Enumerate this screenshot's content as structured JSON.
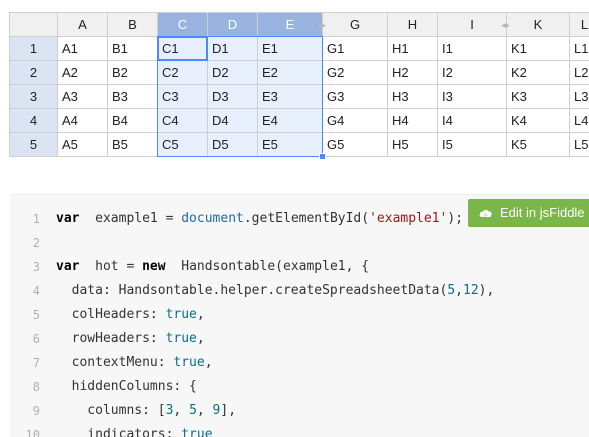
{
  "colors": {
    "header_bg": "#f0f0f0",
    "header_selected_bg": "#99b3df",
    "cell_selected_bg": "#e6effb",
    "selection_border": "#4b89ff",
    "grid_line": "#cfcfcf",
    "jsfiddle_green": "#7ab648",
    "code_bg": "#f7f7f7"
  },
  "spreadsheet": {
    "column_headers": [
      "A",
      "B",
      "C",
      "D",
      "E",
      "G",
      "H",
      "I",
      "K",
      "L"
    ],
    "selected_columns": [
      "C",
      "D",
      "E"
    ],
    "hidden_column_markers": [
      "after E (F hidden)",
      "after I (J hidden)"
    ],
    "row_headers": [
      "1",
      "2",
      "3",
      "4",
      "5"
    ],
    "selected_rows": [
      "1",
      "2",
      "3",
      "4",
      "5"
    ],
    "active_cell": "C1",
    "rows": [
      [
        "A1",
        "B1",
        "C1",
        "D1",
        "E1",
        "G1",
        "H1",
        "I1",
        "K1",
        "L1"
      ],
      [
        "A2",
        "B2",
        "C2",
        "D2",
        "E2",
        "G2",
        "H2",
        "I2",
        "K2",
        "L2"
      ],
      [
        "A3",
        "B3",
        "C3",
        "D3",
        "E3",
        "G3",
        "H3",
        "I3",
        "K3",
        "L3"
      ],
      [
        "A4",
        "B4",
        "C4",
        "D4",
        "E4",
        "G4",
        "H4",
        "I4",
        "K4",
        "L4"
      ],
      [
        "A5",
        "B5",
        "C5",
        "D5",
        "E5",
        "G5",
        "H5",
        "I5",
        "K5",
        "L5"
      ]
    ]
  },
  "code": {
    "lines": [
      {
        "n": "1",
        "tokens": [
          [
            "kw",
            "var"
          ],
          [
            "",
            "  example1 = "
          ],
          [
            "fn",
            "document"
          ],
          [
            "",
            ".getElementById("
          ],
          [
            "str",
            "'example1'"
          ],
          [
            "",
            ");"
          ]
        ]
      },
      {
        "n": "2",
        "tokens": []
      },
      {
        "n": "3",
        "tokens": [
          [
            "kw",
            "var"
          ],
          [
            "",
            "  hot = "
          ],
          [
            "kw",
            "new"
          ],
          [
            "",
            "  Handsontable(example1, {"
          ]
        ]
      },
      {
        "n": "4",
        "tokens": [
          [
            "",
            "  data: Handsontable.helper.createSpreadsheetData("
          ],
          [
            "num",
            "5"
          ],
          [
            "",
            ","
          ],
          [
            "num",
            "12"
          ],
          [
            "",
            "),"
          ]
        ]
      },
      {
        "n": "5",
        "tokens": [
          [
            "",
            "  colHeaders: "
          ],
          [
            "bool",
            "true"
          ],
          [
            "",
            ","
          ]
        ]
      },
      {
        "n": "6",
        "tokens": [
          [
            "",
            "  rowHeaders: "
          ],
          [
            "bool",
            "true"
          ],
          [
            "",
            ","
          ]
        ]
      },
      {
        "n": "7",
        "tokens": [
          [
            "",
            "  contextMenu: "
          ],
          [
            "bool",
            "true"
          ],
          [
            "",
            ","
          ]
        ]
      },
      {
        "n": "8",
        "tokens": [
          [
            "",
            "  hiddenColumns: {"
          ]
        ]
      },
      {
        "n": "9",
        "tokens": [
          [
            "",
            "    columns: ["
          ],
          [
            "num",
            "3"
          ],
          [
            "",
            ", "
          ],
          [
            "num",
            "5"
          ],
          [
            "",
            ", "
          ],
          [
            "num",
            "9"
          ],
          [
            "",
            "],"
          ]
        ]
      },
      {
        "n": "10",
        "tokens": [
          [
            "",
            "    indicators: "
          ],
          [
            "bool",
            "true"
          ]
        ]
      }
    ],
    "jsfiddle_label": "Edit in jsFiddle"
  }
}
